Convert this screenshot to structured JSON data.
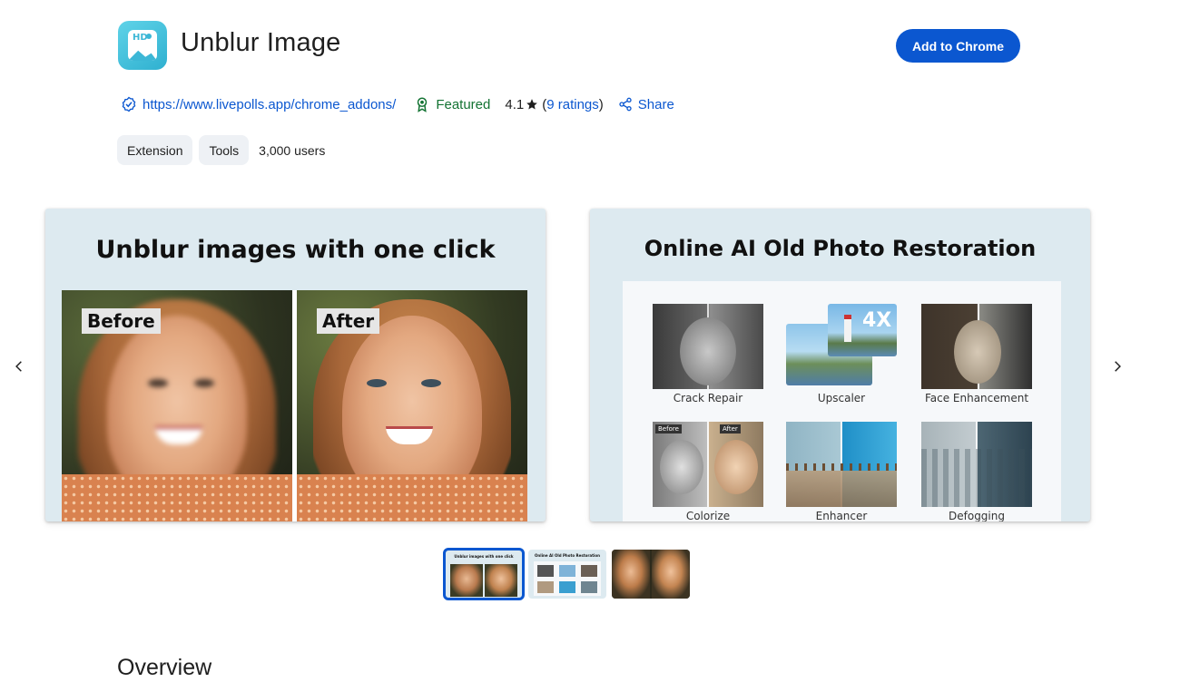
{
  "app": {
    "title": "Unblur Image",
    "icon": "hd-image-icon",
    "icon_text": "HD"
  },
  "header": {
    "add_button_label": "Add to Chrome"
  },
  "meta": {
    "url": "https://www.livepolls.app/chrome_addons/",
    "featured_label": "Featured",
    "rating_value": "4.1",
    "rating_open": "(",
    "rating_count": "9 ratings",
    "rating_close": ")",
    "share_label": "Share"
  },
  "chips": {
    "category_1": "Extension",
    "category_2": "Tools",
    "users": "3,000 users"
  },
  "carousel": {
    "slide1": {
      "heading": "Unblur images with one click",
      "before_label": "Before",
      "after_label": "After"
    },
    "slide2": {
      "heading": "Online AI Old Photo Restoration",
      "features": [
        {
          "caption": "Crack Repair"
        },
        {
          "caption": "Upscaler",
          "badge": "4X"
        },
        {
          "caption": "Face Enhancement"
        },
        {
          "caption": "Colorize",
          "before_tag": "Before",
          "after_tag": "After"
        },
        {
          "caption": "Enhancer"
        },
        {
          "caption": "Defogging"
        }
      ]
    },
    "thumbnails": [
      {
        "label": "Unblur images with one click",
        "active": true
      },
      {
        "label": "Online AI Old Photo Restoration",
        "active": false
      },
      {
        "label": "",
        "active": false
      }
    ]
  },
  "section": {
    "overview_title": "Overview"
  },
  "colors": {
    "accent": "#0b57d0",
    "featured": "#137333",
    "slide_bg": "#ddeaf0"
  }
}
